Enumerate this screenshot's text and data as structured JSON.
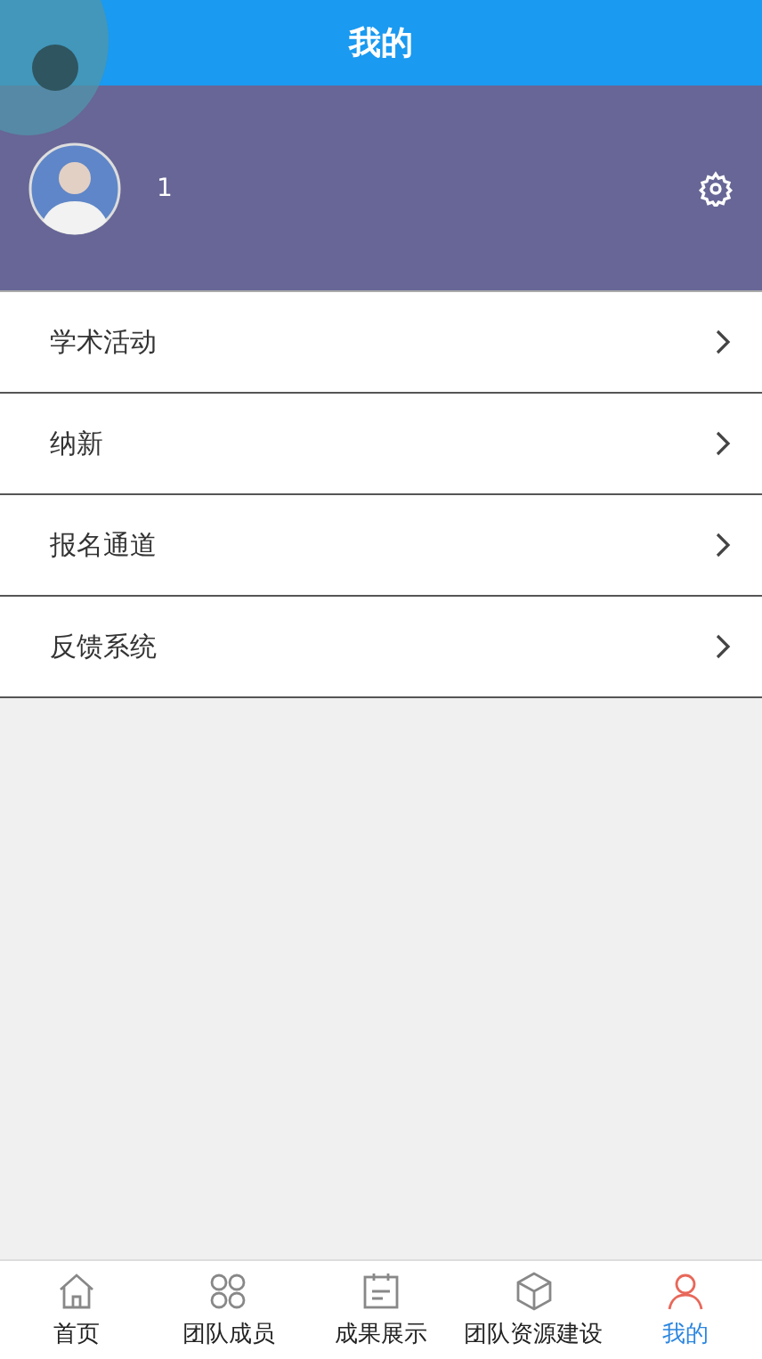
{
  "header": {
    "title": "我的"
  },
  "profile": {
    "name": "1"
  },
  "menu": [
    {
      "label": "学术活动"
    },
    {
      "label": "纳新"
    },
    {
      "label": "报名通道"
    },
    {
      "label": "反馈系统"
    }
  ],
  "tabs": [
    {
      "label": "首页",
      "kind": "home",
      "selected": false
    },
    {
      "label": "团队成员",
      "kind": "team",
      "selected": false
    },
    {
      "label": "成果展示",
      "kind": "board",
      "selected": false
    },
    {
      "label": "团队资源建设",
      "kind": "box",
      "selected": false
    },
    {
      "label": "我的",
      "kind": "user",
      "selected": true
    }
  ]
}
